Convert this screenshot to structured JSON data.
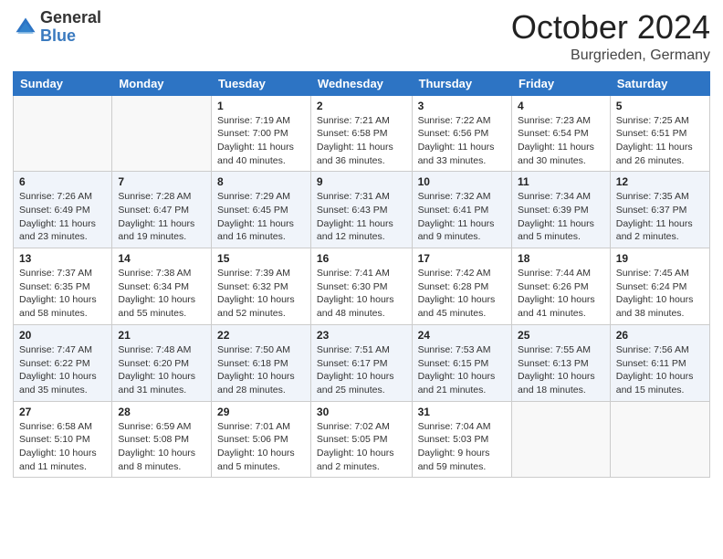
{
  "header": {
    "logo_general": "General",
    "logo_blue": "Blue",
    "month": "October 2024",
    "location": "Burgrieden, Germany"
  },
  "weekdays": [
    "Sunday",
    "Monday",
    "Tuesday",
    "Wednesday",
    "Thursday",
    "Friday",
    "Saturday"
  ],
  "weeks": [
    [
      {
        "day": "",
        "info": ""
      },
      {
        "day": "",
        "info": ""
      },
      {
        "day": "1",
        "info": "Sunrise: 7:19 AM\nSunset: 7:00 PM\nDaylight: 11 hours and 40 minutes."
      },
      {
        "day": "2",
        "info": "Sunrise: 7:21 AM\nSunset: 6:58 PM\nDaylight: 11 hours and 36 minutes."
      },
      {
        "day": "3",
        "info": "Sunrise: 7:22 AM\nSunset: 6:56 PM\nDaylight: 11 hours and 33 minutes."
      },
      {
        "day": "4",
        "info": "Sunrise: 7:23 AM\nSunset: 6:54 PM\nDaylight: 11 hours and 30 minutes."
      },
      {
        "day": "5",
        "info": "Sunrise: 7:25 AM\nSunset: 6:51 PM\nDaylight: 11 hours and 26 minutes."
      }
    ],
    [
      {
        "day": "6",
        "info": "Sunrise: 7:26 AM\nSunset: 6:49 PM\nDaylight: 11 hours and 23 minutes."
      },
      {
        "day": "7",
        "info": "Sunrise: 7:28 AM\nSunset: 6:47 PM\nDaylight: 11 hours and 19 minutes."
      },
      {
        "day": "8",
        "info": "Sunrise: 7:29 AM\nSunset: 6:45 PM\nDaylight: 11 hours and 16 minutes."
      },
      {
        "day": "9",
        "info": "Sunrise: 7:31 AM\nSunset: 6:43 PM\nDaylight: 11 hours and 12 minutes."
      },
      {
        "day": "10",
        "info": "Sunrise: 7:32 AM\nSunset: 6:41 PM\nDaylight: 11 hours and 9 minutes."
      },
      {
        "day": "11",
        "info": "Sunrise: 7:34 AM\nSunset: 6:39 PM\nDaylight: 11 hours and 5 minutes."
      },
      {
        "day": "12",
        "info": "Sunrise: 7:35 AM\nSunset: 6:37 PM\nDaylight: 11 hours and 2 minutes."
      }
    ],
    [
      {
        "day": "13",
        "info": "Sunrise: 7:37 AM\nSunset: 6:35 PM\nDaylight: 10 hours and 58 minutes."
      },
      {
        "day": "14",
        "info": "Sunrise: 7:38 AM\nSunset: 6:34 PM\nDaylight: 10 hours and 55 minutes."
      },
      {
        "day": "15",
        "info": "Sunrise: 7:39 AM\nSunset: 6:32 PM\nDaylight: 10 hours and 52 minutes."
      },
      {
        "day": "16",
        "info": "Sunrise: 7:41 AM\nSunset: 6:30 PM\nDaylight: 10 hours and 48 minutes."
      },
      {
        "day": "17",
        "info": "Sunrise: 7:42 AM\nSunset: 6:28 PM\nDaylight: 10 hours and 45 minutes."
      },
      {
        "day": "18",
        "info": "Sunrise: 7:44 AM\nSunset: 6:26 PM\nDaylight: 10 hours and 41 minutes."
      },
      {
        "day": "19",
        "info": "Sunrise: 7:45 AM\nSunset: 6:24 PM\nDaylight: 10 hours and 38 minutes."
      }
    ],
    [
      {
        "day": "20",
        "info": "Sunrise: 7:47 AM\nSunset: 6:22 PM\nDaylight: 10 hours and 35 minutes."
      },
      {
        "day": "21",
        "info": "Sunrise: 7:48 AM\nSunset: 6:20 PM\nDaylight: 10 hours and 31 minutes."
      },
      {
        "day": "22",
        "info": "Sunrise: 7:50 AM\nSunset: 6:18 PM\nDaylight: 10 hours and 28 minutes."
      },
      {
        "day": "23",
        "info": "Sunrise: 7:51 AM\nSunset: 6:17 PM\nDaylight: 10 hours and 25 minutes."
      },
      {
        "day": "24",
        "info": "Sunrise: 7:53 AM\nSunset: 6:15 PM\nDaylight: 10 hours and 21 minutes."
      },
      {
        "day": "25",
        "info": "Sunrise: 7:55 AM\nSunset: 6:13 PM\nDaylight: 10 hours and 18 minutes."
      },
      {
        "day": "26",
        "info": "Sunrise: 7:56 AM\nSunset: 6:11 PM\nDaylight: 10 hours and 15 minutes."
      }
    ],
    [
      {
        "day": "27",
        "info": "Sunrise: 6:58 AM\nSunset: 5:10 PM\nDaylight: 10 hours and 11 minutes."
      },
      {
        "day": "28",
        "info": "Sunrise: 6:59 AM\nSunset: 5:08 PM\nDaylight: 10 hours and 8 minutes."
      },
      {
        "day": "29",
        "info": "Sunrise: 7:01 AM\nSunset: 5:06 PM\nDaylight: 10 hours and 5 minutes."
      },
      {
        "day": "30",
        "info": "Sunrise: 7:02 AM\nSunset: 5:05 PM\nDaylight: 10 hours and 2 minutes."
      },
      {
        "day": "31",
        "info": "Sunrise: 7:04 AM\nSunset: 5:03 PM\nDaylight: 9 hours and 59 minutes."
      },
      {
        "day": "",
        "info": ""
      },
      {
        "day": "",
        "info": ""
      }
    ]
  ]
}
